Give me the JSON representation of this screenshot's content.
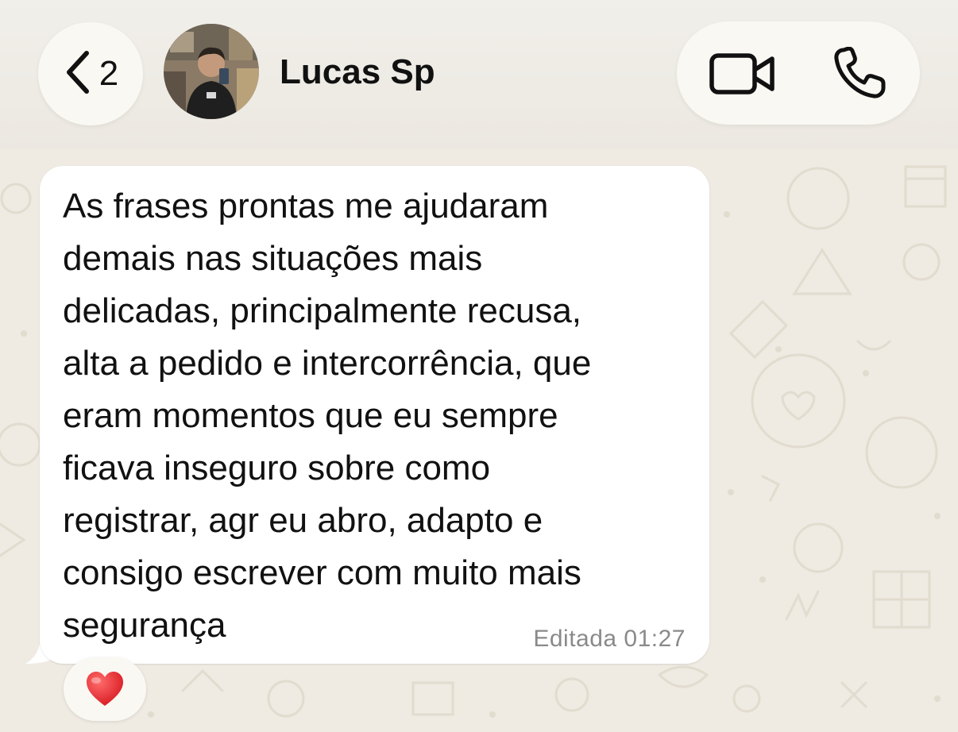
{
  "header": {
    "back_count": "2",
    "contact_name": "Lucas Sp"
  },
  "message": {
    "text": "As frases prontas me ajudaram\ndemais nas situações mais\ndelicadas, principalmente recusa,\nalta a pedido e intercorrência, que\neram momentos que eu sempre\nficava inseguro sobre como\nregistrar, agr eu abro, adapto e\nconsigo escrever com muito mais\nsegurança",
    "status": "Editada",
    "time": "01:27",
    "reaction": "heart-emoji"
  },
  "colors": {
    "background": "#efeae2",
    "bubble": "#ffffff",
    "pill": "#faf8f2",
    "meta_text": "#8a8a8a",
    "heart": "#e0262d"
  },
  "icons": [
    "chevron-left-icon",
    "video-camera-icon",
    "phone-icon",
    "heart-emoji"
  ]
}
